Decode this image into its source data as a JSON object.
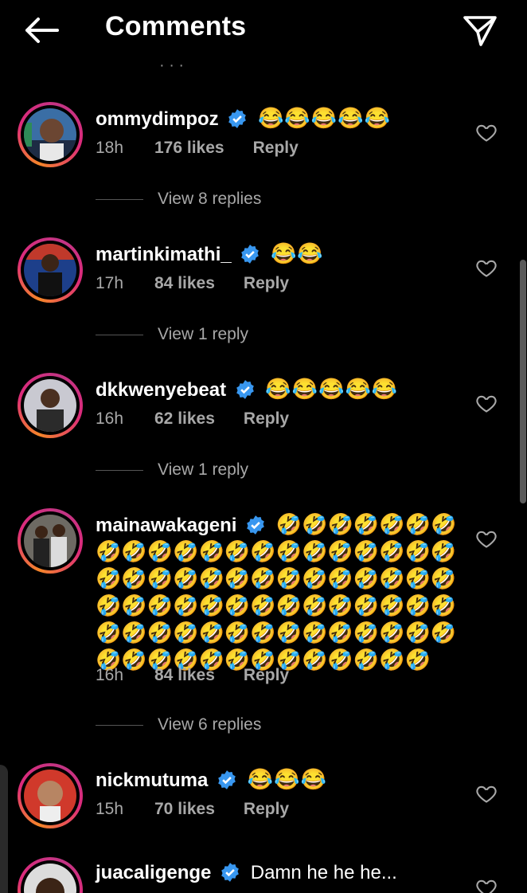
{
  "header": {
    "title": "Comments"
  },
  "cut_text": "· · ·",
  "comments": [
    {
      "username": "ommydimpoz",
      "text": "😂😂😂😂😂",
      "time": "18h",
      "likes": "176 likes",
      "reply": "Reply",
      "view_replies": "View 8 replies"
    },
    {
      "username": "martinkimathi_",
      "text": "😂😂",
      "time": "17h",
      "likes": "84 likes",
      "reply": "Reply",
      "view_replies": "View 1 reply"
    },
    {
      "username": "dkkwenyebeat",
      "text": "😂😂😂😂😂",
      "time": "16h",
      "likes": "62 likes",
      "reply": "Reply",
      "view_replies": "View 1 reply"
    },
    {
      "username": "mainawakageni",
      "text": "🤣🤣🤣🤣🤣🤣🤣🤣🤣🤣🤣🤣🤣🤣🤣🤣🤣🤣🤣🤣🤣🤣🤣🤣🤣🤣🤣🤣🤣🤣🤣🤣🤣🤣🤣🤣🤣🤣🤣🤣🤣🤣🤣🤣🤣🤣🤣🤣🤣🤣🤣🤣🤣🤣🤣🤣🤣🤣🤣🤣🤣🤣🤣🤣🤣🤣🤣🤣🤣🤣🤣🤣🤣🤣🤣🤣",
      "time": "16h",
      "likes": "84 likes",
      "reply": "Reply",
      "view_replies": "View 6 replies"
    },
    {
      "username": "nickmutuma",
      "text": "😂😂😂",
      "time": "15h",
      "likes": "70 likes",
      "reply": "Reply"
    },
    {
      "username": "juacaligenge",
      "text": "Damn he he he..."
    }
  ],
  "icons": {
    "back": "arrow-left-icon",
    "send": "paper-plane-icon",
    "verified": "verified-badge-icon",
    "like": "heart-outline-icon"
  },
  "colors": {
    "background": "#000000",
    "verified": "#3897f0",
    "ring_start": "#f58529",
    "ring_end": "#dd2a7b",
    "muted": "#a8a8a8"
  }
}
